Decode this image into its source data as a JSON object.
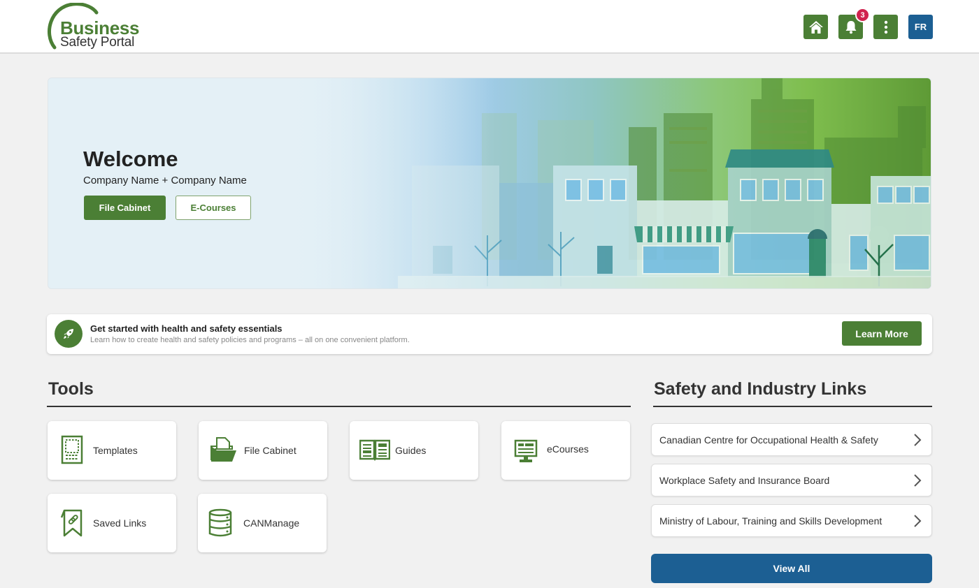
{
  "header": {
    "logo": {
      "line1": "Business",
      "line2": "Safety Portal"
    },
    "buttons": {
      "home_icon": "home-icon",
      "notifications_icon": "bell-icon",
      "notifications_count": "3",
      "menu_icon": "more-vertical-icon",
      "language_label": "FR"
    }
  },
  "hero": {
    "title": "Welcome",
    "subtitle": "Company Name + Company Name",
    "primary_button": "File Cabinet",
    "secondary_button": "E-Courses"
  },
  "banner": {
    "icon": "rocket-icon",
    "title": "Get started with health and safety essentials",
    "description": "Learn how to create health and safety policies and programs – all on one convenient platform.",
    "button": "Learn More"
  },
  "tools": {
    "title": "Tools",
    "items": [
      {
        "label": "Templates",
        "icon": "template-icon"
      },
      {
        "label": "File Cabinet",
        "icon": "folder-icon"
      },
      {
        "label": "Guides",
        "icon": "book-icon"
      },
      {
        "label": "eCourses",
        "icon": "monitor-icon"
      },
      {
        "label": "Saved Links",
        "icon": "bookmark-link-icon"
      },
      {
        "label": "CANManage",
        "icon": "database-icon"
      }
    ]
  },
  "links": {
    "title": "Safety and Industry Links",
    "items": [
      {
        "label": "Canadian Centre for Occupational Health & Safety"
      },
      {
        "label": "Workplace Safety and Insurance Board"
      },
      {
        "label": "Ministry of Labour, Training and Skills Development"
      }
    ],
    "view_all": "View All"
  },
  "colors": {
    "brand_green": "#4b7f35",
    "brand_blue": "#1c5f93",
    "badge_red": "#d0234e",
    "page_bg": "#f1f1f1"
  }
}
